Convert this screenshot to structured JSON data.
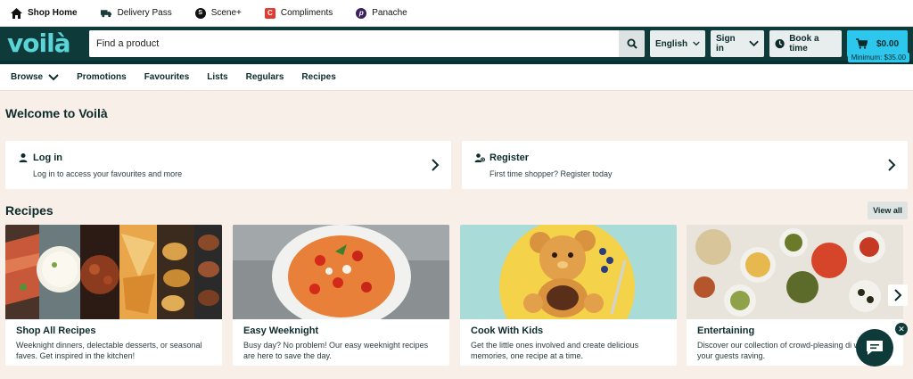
{
  "brand_tabs": [
    {
      "label": "Shop Home",
      "icon": "home-icon"
    },
    {
      "label": "Delivery Pass",
      "icon": "truck-icon"
    },
    {
      "label": "Scene+",
      "icon": "scene-plus-icon"
    },
    {
      "label": "Compliments",
      "icon": "compliments-icon"
    },
    {
      "label": "Panache",
      "icon": "panache-icon"
    }
  ],
  "header": {
    "logo_text": "voilà",
    "search_placeholder": "Find a product",
    "language": "English",
    "signin": "Sign in",
    "book_time": "Book a time",
    "cart_total": "$0.00",
    "cart_minimum": "Minimum: $35.00"
  },
  "nav": {
    "browse": "Browse",
    "items": [
      "Promotions",
      "Favourites",
      "Lists",
      "Regulars",
      "Recipes"
    ]
  },
  "welcome": "Welcome to Voilà",
  "login_card": {
    "title": "Log in",
    "subtitle": "Log in to access your favourites and more"
  },
  "register_card": {
    "title": "Register",
    "subtitle": "First time shopper? Register today"
  },
  "recipes": {
    "heading": "Recipes",
    "view_all": "View all",
    "cards": [
      {
        "title": "Shop All Recipes",
        "desc": "Weeknight dinners, delectable desserts, or seasonal faves. Get inspired in the kitchen!"
      },
      {
        "title": "Easy Weeknight",
        "desc": "Busy day? No problem! Our easy weeknight recipes are here to save the day."
      },
      {
        "title": "Cook With Kids",
        "desc": "Get the little ones involved and create delicious memories, one recipe at a time."
      },
      {
        "title": "Entertaining",
        "desc": "Discover our collection of crowd-pleasing di will leave your guests raving."
      }
    ]
  },
  "colors": {
    "header_bg": "#0e3a3a",
    "logo": "#5bd4d8",
    "cart": "#2dc6ec",
    "page_bg": "#f7efe8"
  }
}
